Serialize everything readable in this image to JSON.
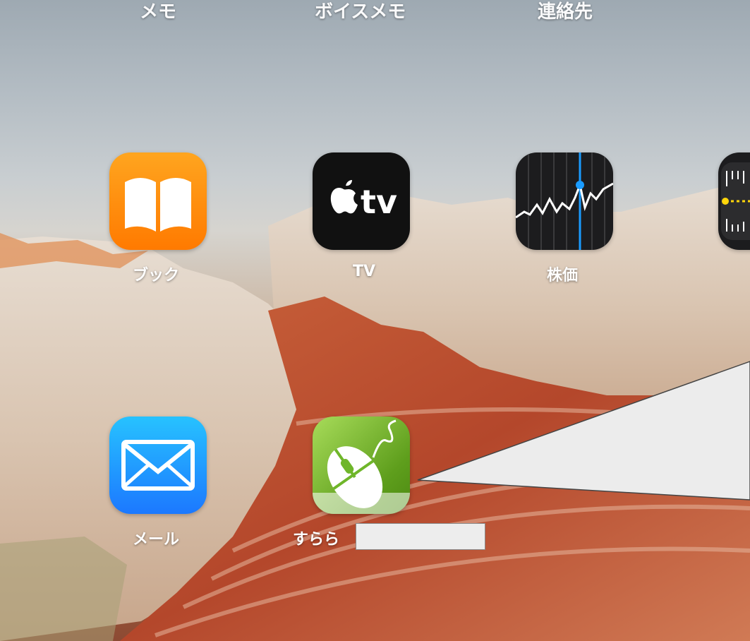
{
  "dock_row": {
    "items": [
      {
        "label": "メモ"
      },
      {
        "label": "ボイスメモ"
      },
      {
        "label": "連絡先"
      }
    ]
  },
  "apps": {
    "books": {
      "label": "ブック",
      "color": "#ff8a00"
    },
    "tv": {
      "label": "TV",
      "color": "#111111"
    },
    "stocks": {
      "label": "株価",
      "color": "#1c1c1e"
    },
    "measure": {
      "label": ""
    },
    "mail": {
      "label": "メール",
      "color": "#1e9bff"
    },
    "surala": {
      "label": "すらら",
      "color": "#6fb62a"
    }
  },
  "callout": {
    "color": "#ececec"
  }
}
